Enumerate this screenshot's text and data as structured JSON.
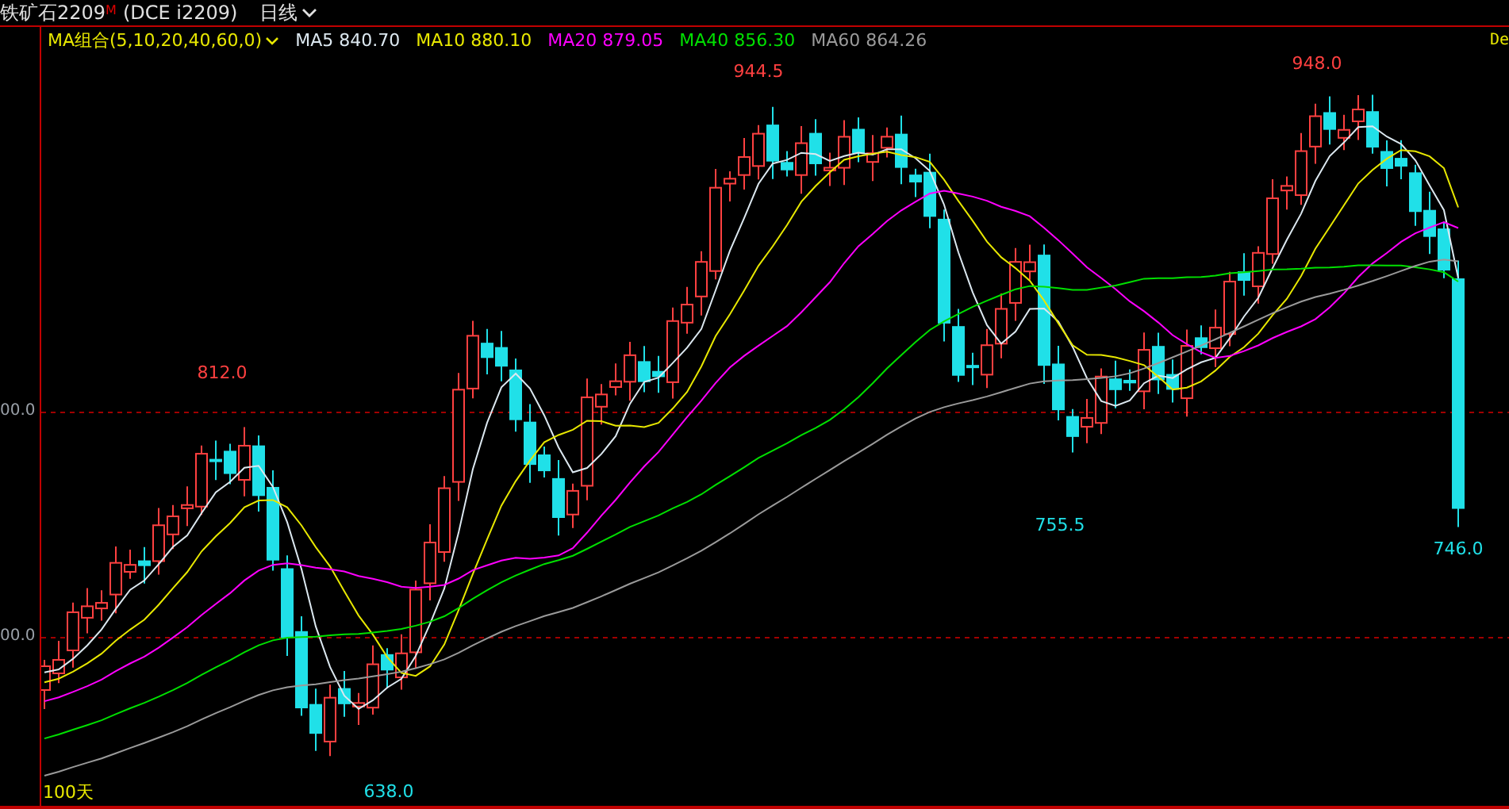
{
  "title": {
    "symbol": "铁矿石2209",
    "mark": "M",
    "exchange": "(DCE i2209)",
    "period": "日线"
  },
  "indicator": {
    "name": "MA组合(5,10,20,40,60,0)",
    "values": [
      {
        "label": "MA5 840.70",
        "color": "#dce8f0"
      },
      {
        "label": "MA10 880.10",
        "color": "#e8e800"
      },
      {
        "label": "MA20 879.05",
        "color": "#ff00ff"
      },
      {
        "label": "MA40 856.30",
        "color": "#00e000"
      },
      {
        "label": "MA60 864.26",
        "color": "#9a9a9a"
      }
    ]
  },
  "right_label": "De",
  "price_axis": [
    "00.0",
    "00.0"
  ],
  "price_marks": [
    {
      "text": "812.0",
      "kind": "high"
    },
    {
      "text": "944.5",
      "kind": "high"
    },
    {
      "text": "948.0",
      "kind": "high"
    },
    {
      "text": "755.5",
      "kind": "low"
    },
    {
      "text": "746.0",
      "kind": "low"
    },
    {
      "text": "638.0",
      "kind": "low"
    }
  ],
  "range_label": "100天"
}
